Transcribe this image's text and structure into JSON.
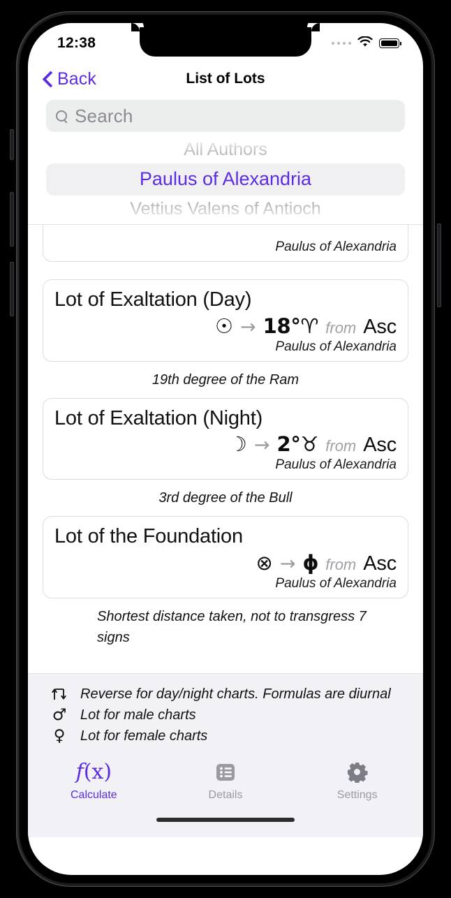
{
  "status_bar": {
    "time": "12:38",
    "cellular": "signal-dots",
    "wifi": "wifi-icon",
    "battery": "battery-full-icon"
  },
  "nav": {
    "back_label": "Back",
    "title": "List of Lots"
  },
  "search": {
    "placeholder": "Search",
    "value": ""
  },
  "author_picker": {
    "above": "All Authors",
    "selected": "Paulus of Alexandria",
    "below": "Vettius Valens of Antioch"
  },
  "colors": {
    "accent": "#5b2ce3",
    "field_bg": "#eceded",
    "legend_bg": "#f1f1f6",
    "muted": "#9a9aa0"
  },
  "list": {
    "clipped_card": {
      "attrib": "Paulus of Alexandria"
    },
    "cards": [
      {
        "title": "Lot of Exaltation (Day)",
        "from_glyph": "☉",
        "arrow": "→",
        "value": "18°♈",
        "from_word": "from",
        "target": "Asc",
        "attrib": "Paulus of Alexandria",
        "caption": "19th degree of the Ram"
      },
      {
        "title": "Lot of Exaltation (Night)",
        "from_glyph": "☽",
        "arrow": "→",
        "value": "2°♉",
        "from_word": "from",
        "target": "Asc",
        "attrib": "Paulus of Alexandria",
        "caption": "3rd degree of the Bull"
      },
      {
        "title": "Lot of the Foundation",
        "from_glyph": "⊗",
        "arrow": "→",
        "value": "ϕ",
        "from_word": "from",
        "target": "Asc",
        "attrib": "Paulus of Alexandria",
        "caption": "Shortest distance taken, not to transgress 7 signs"
      }
    ]
  },
  "legend": [
    {
      "icon": "reverse-arrows-icon",
      "glyph": "",
      "text": "Reverse for day/night charts. Formulas are diurnal"
    },
    {
      "icon": "mars-male-icon",
      "glyph": "♂",
      "text": "Lot for male charts"
    },
    {
      "icon": "venus-female-icon",
      "glyph": "♀",
      "text": "Lot for female charts"
    }
  ],
  "tabs": [
    {
      "label": "Calculate",
      "icon": "function-fx-icon",
      "active": true
    },
    {
      "label": "Details",
      "icon": "list-bullet-icon",
      "active": false
    },
    {
      "label": "Settings",
      "icon": "gear-icon",
      "active": false
    }
  ]
}
